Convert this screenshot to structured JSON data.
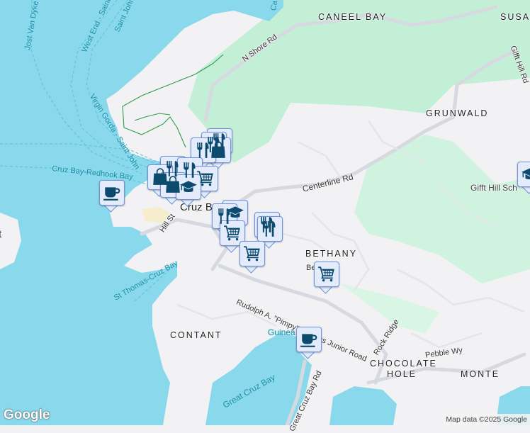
{
  "colors": {
    "water": "#8ad8ec",
    "land": "#f2f2f4",
    "park": "#c3efd6",
    "marker_fill": "#e4ecfb",
    "marker_border": "#6f93dc",
    "icon": "#0c4a6e"
  },
  "labels": {
    "caneel_bay": "CANEEL BAY",
    "susan": "SUSAN",
    "n_shore_rd": "N Shore Rd",
    "gifft_hill_rd": "Gifft Hill Rd",
    "grunwald": "GRUNWALD",
    "gifft_hill_school": "Gifft Hill Sch",
    "centerline_rd": "Centerline Rd",
    "cruz_bay": "Cruz Bay",
    "hill_st": "Hill St",
    "bethany": "BETHANY",
    "be_rd": "Be     Rd",
    "rudolph_rd": "Rudolph A. \"Pimpy\" Thomas Junior Road",
    "contant": "CONTANT",
    "guinea": "Guinea",
    "rock_ridge": "Rock Ridge",
    "pebble_wy": "Pebble Wy",
    "chocolate_hole": "CHOCOLATE HOLE",
    "monte": "MONTE",
    "great_cruz_bay": "Great Cruz Bay",
    "great_cruz_bay_rd": "Great Cruz Bay Rd",
    "st_thomas_cruz_bay": "St Thomas-Cruz Bay",
    "cruz_bay_redhook": "Cruz Bay-Redhook Bay",
    "virgin_gorda": "Virgin Gorda - Saint John",
    "west_end": "West End - Saint",
    "saint_john": "Saint John",
    "jost_van_dyke": "Jost Van Dyke",
    "ca": "Ca",
    "t": "t"
  },
  "markers": [
    {
      "icon": "restaurant"
    },
    {
      "icon": "restaurant"
    },
    {
      "icon": "shopping"
    },
    {
      "icon": "restaurant"
    },
    {
      "icon": "restaurant"
    },
    {
      "icon": "restaurant"
    },
    {
      "icon": "shopping"
    },
    {
      "icon": "cart"
    },
    {
      "icon": "shopping"
    },
    {
      "icon": "school"
    },
    {
      "icon": "coffee"
    },
    {
      "icon": "school"
    },
    {
      "icon": "restaurant"
    },
    {
      "icon": "restaurant"
    },
    {
      "icon": "restaurant"
    },
    {
      "icon": "cart"
    },
    {
      "icon": "cart"
    },
    {
      "icon": "cart"
    },
    {
      "icon": "coffee"
    },
    {
      "icon": "school"
    }
  ],
  "footer": {
    "logo": "Google",
    "attribution": "Map data ©2025 Google"
  }
}
